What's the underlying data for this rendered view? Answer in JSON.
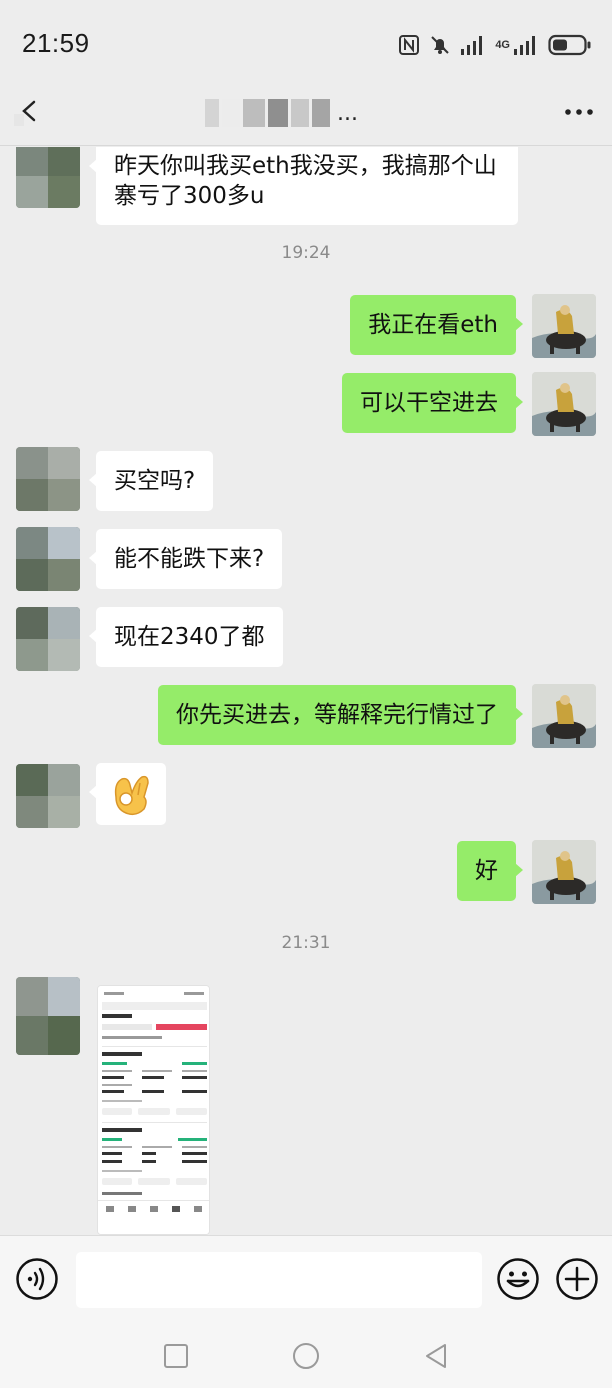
{
  "status_bar": {
    "time": "21:59",
    "network": "4G"
  },
  "header": {
    "title_suffix": "...",
    "back_icon": "chevron-left-icon",
    "more_icon": "more-dots-icon"
  },
  "messages": [
    {
      "side": "left",
      "text": "昨天你叫我买eth我没买，我搞那个山寨亏了300多u"
    },
    {
      "type": "time",
      "text": "19:24"
    },
    {
      "side": "right",
      "text": "我正在看eth"
    },
    {
      "side": "right",
      "text": "可以干空进去"
    },
    {
      "side": "left",
      "text": "买空吗?"
    },
    {
      "side": "left",
      "text": "能不能跌下来?"
    },
    {
      "side": "left",
      "text": "现在2340了都"
    },
    {
      "side": "right",
      "text": "你先买进去，等解释完行情过了"
    },
    {
      "side": "left",
      "type": "emoji",
      "emoji": "ok-hand"
    },
    {
      "side": "right",
      "text": "好"
    },
    {
      "type": "time",
      "text": "21:31"
    },
    {
      "side": "left",
      "type": "image",
      "image": "trading-app-screenshot"
    }
  ],
  "input_bar": {
    "placeholder": "",
    "voice_icon": "voice-icon",
    "emoji_icon": "smiley-icon",
    "plus_icon": "plus-icon"
  },
  "nav_bar": {
    "icons": [
      "recent-apps-icon",
      "home-icon",
      "back-icon"
    ]
  },
  "colors": {
    "background": "#ededed",
    "sent_bubble": "#95ec69",
    "received_bubble": "#ffffff",
    "timestamp": "#8a8a8a"
  }
}
